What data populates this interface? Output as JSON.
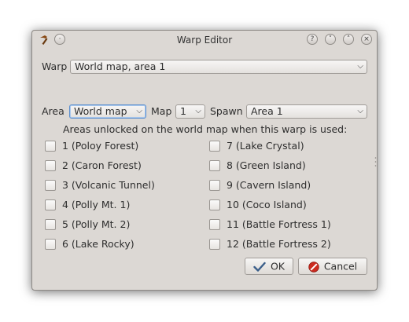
{
  "window": {
    "title": "Warp Editor",
    "title_buttons": {
      "help": "?",
      "minimize": "˅",
      "maximize": "˄",
      "close": "×"
    }
  },
  "warp": {
    "label": "Warp",
    "selected": "World map, area 1"
  },
  "area": {
    "label": "Area",
    "selected": "World map"
  },
  "map": {
    "label": "Map",
    "selected": "1"
  },
  "spawn": {
    "label": "Spawn",
    "selected": "Area 1"
  },
  "areas_heading": "Areas unlocked on the world map when this warp is used:",
  "areas": [
    {
      "label": "1 (Poloy Forest)",
      "checked": false
    },
    {
      "label": "2 (Caron Forest)",
      "checked": false
    },
    {
      "label": "3 (Volcanic Tunnel)",
      "checked": false
    },
    {
      "label": "4 (Polly Mt. 1)",
      "checked": false
    },
    {
      "label": "5 (Polly Mt. 2)",
      "checked": false
    },
    {
      "label": "6 (Lake Rocky)",
      "checked": false
    },
    {
      "label": "7 (Lake Crystal)",
      "checked": false
    },
    {
      "label": "8 (Green Island)",
      "checked": false
    },
    {
      "label": "9 (Cavern Island)",
      "checked": false
    },
    {
      "label": "10 (Coco Island)",
      "checked": false
    },
    {
      "label": "11 (Battle Fortress 1)",
      "checked": false
    },
    {
      "label": "12 (Battle Fortress 2)",
      "checked": false
    }
  ],
  "buttons": {
    "ok": "OK",
    "cancel": "Cancel"
  },
  "icons": {
    "app": "hammer-icon",
    "ok": "checkmark-icon",
    "cancel": "no-entry-icon"
  },
  "colors": {
    "dialog_bg": "#dcd8d4",
    "focus": "#5b8fcf",
    "ok_icon": "#3b5f8a",
    "cancel_icon": "#cc2a1f"
  }
}
